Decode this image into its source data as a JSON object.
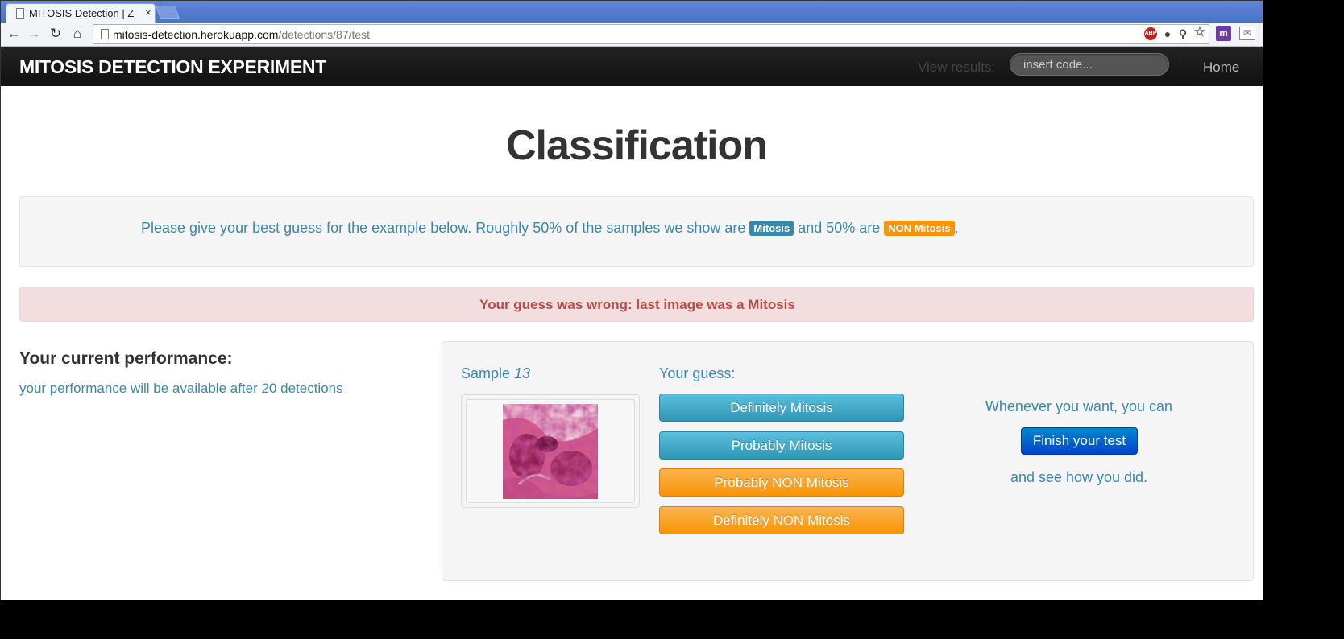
{
  "browser": {
    "tab_title": "MITOSIS Detection | Z",
    "tab_close": "×",
    "url_host": "mitosis-detection.herokuapp.com",
    "url_path": "/detections/87/test",
    "extensions": [
      "adblock-plus-icon",
      "lightbulb-icon",
      "zoom-icon",
      "bookmark-star-icon",
      "m-extension-icon",
      "gmail-icon"
    ],
    "abp_text": "ABP",
    "m_ext_text": "m"
  },
  "navbar": {
    "brand": "MITOSIS DETECTION EXPERIMENT",
    "view_results_label": "View results:",
    "code_placeholder": "insert code...",
    "home_link": "Home"
  },
  "page": {
    "title": "Classification",
    "instructions": {
      "part1": "Please give your best guess for the example below. Roughly 50% of the samples we show are ",
      "label_mitosis": "Mitosis",
      "part2": " and 50% are ",
      "label_non": "NON Mitosis",
      "part3": "."
    },
    "alert": "Your guess was wrong: last image was a Mitosis",
    "performance": {
      "heading": "Your current performance:",
      "text": "your performance will be available after 20 detections"
    },
    "test": {
      "sample_label": "Sample ",
      "sample_number": "13",
      "guess_label": "Your guess:",
      "buttons": {
        "definitely_mitosis": "Definitely Mitosis",
        "probably_mitosis": "Probably Mitosis",
        "probably_non": "Probably NON Mitosis",
        "definitely_non": "Definitely NON Mitosis"
      },
      "whenever": "Whenever you want, you can",
      "finish_button": "Finish your test",
      "see_how": "and see how you did."
    }
  },
  "colors": {
    "info": "#3a87ad",
    "warning": "#f89406",
    "error_text": "#b94a48",
    "error_bg": "#f2dede",
    "primary": "#0055cc",
    "navbar": "#1b1b1b"
  }
}
